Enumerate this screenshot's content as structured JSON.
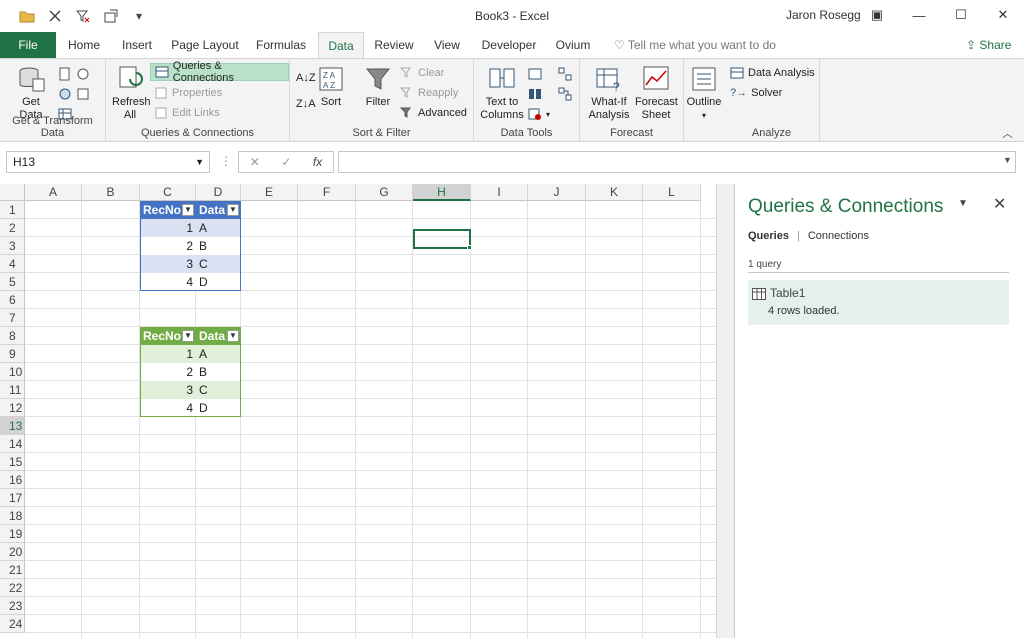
{
  "window": {
    "title": "Book3  -  Excel",
    "user": "Jaron Rosegg"
  },
  "tabs": [
    {
      "label": "File"
    },
    {
      "label": "Home"
    },
    {
      "label": "Insert"
    },
    {
      "label": "Page Layout"
    },
    {
      "label": "Formulas"
    },
    {
      "label": "Data"
    },
    {
      "label": "Review"
    },
    {
      "label": "View"
    },
    {
      "label": "Developer"
    },
    {
      "label": "Ovium"
    }
  ],
  "tellme": "Tell me what you want to do",
  "share": "Share",
  "ribbon": {
    "get_transform": {
      "get_data": "Get Data",
      "group": "Get & Transform Data"
    },
    "queries": {
      "refresh": "Refresh All",
      "queries_connections": "Queries & Connections",
      "properties": "Properties",
      "edit_links": "Edit Links",
      "group": "Queries & Connections"
    },
    "sort_filter": {
      "sort": "Sort",
      "filter": "Filter",
      "clear": "Clear",
      "reapply": "Reapply",
      "advanced": "Advanced",
      "group": "Sort & Filter"
    },
    "data_tools": {
      "text_to_columns": "Text to Columns",
      "group": "Data Tools"
    },
    "forecast": {
      "what_if": "What-If Analysis",
      "forecast_sheet": "Forecast Sheet",
      "group": "Forecast"
    },
    "outline": {
      "label": "Outline"
    },
    "analyze": {
      "data_analysis": "Data Analysis",
      "solver": "Solver",
      "group": "Analyze"
    }
  },
  "formula_bar": {
    "name_box": "H13",
    "formula": ""
  },
  "sheet": {
    "columns": [
      "A",
      "B",
      "C",
      "D",
      "E",
      "F",
      "G",
      "H",
      "I",
      "J",
      "K",
      "L"
    ],
    "selected_column": "H",
    "rows": [
      "1",
      "2",
      "3",
      "4",
      "5",
      "6",
      "7",
      "8",
      "9",
      "10",
      "11",
      "12",
      "13",
      "14",
      "15",
      "16",
      "17",
      "18",
      "19",
      "20",
      "21",
      "22",
      "23",
      "24"
    ],
    "selected_row": "13",
    "table1": {
      "headers": [
        "RecNo",
        "Data"
      ],
      "rows": [
        [
          "1",
          "A"
        ],
        [
          "2",
          "B"
        ],
        [
          "3",
          "C"
        ],
        [
          "4",
          "D"
        ]
      ],
      "color": "#4472c4",
      "band": "#d9e1f2"
    },
    "table2": {
      "headers": [
        "RecNo",
        "Data"
      ],
      "rows": [
        [
          "1",
          "A"
        ],
        [
          "2",
          "B"
        ],
        [
          "3",
          "C"
        ],
        [
          "4",
          "D"
        ]
      ],
      "color": "#70ad47",
      "band": "#e2efda"
    }
  },
  "pane": {
    "title": "Queries & Connections",
    "tab_queries": "Queries",
    "tab_connections": "Connections",
    "count": "1 query",
    "query_name": "Table1",
    "query_status": "4 rows loaded."
  }
}
